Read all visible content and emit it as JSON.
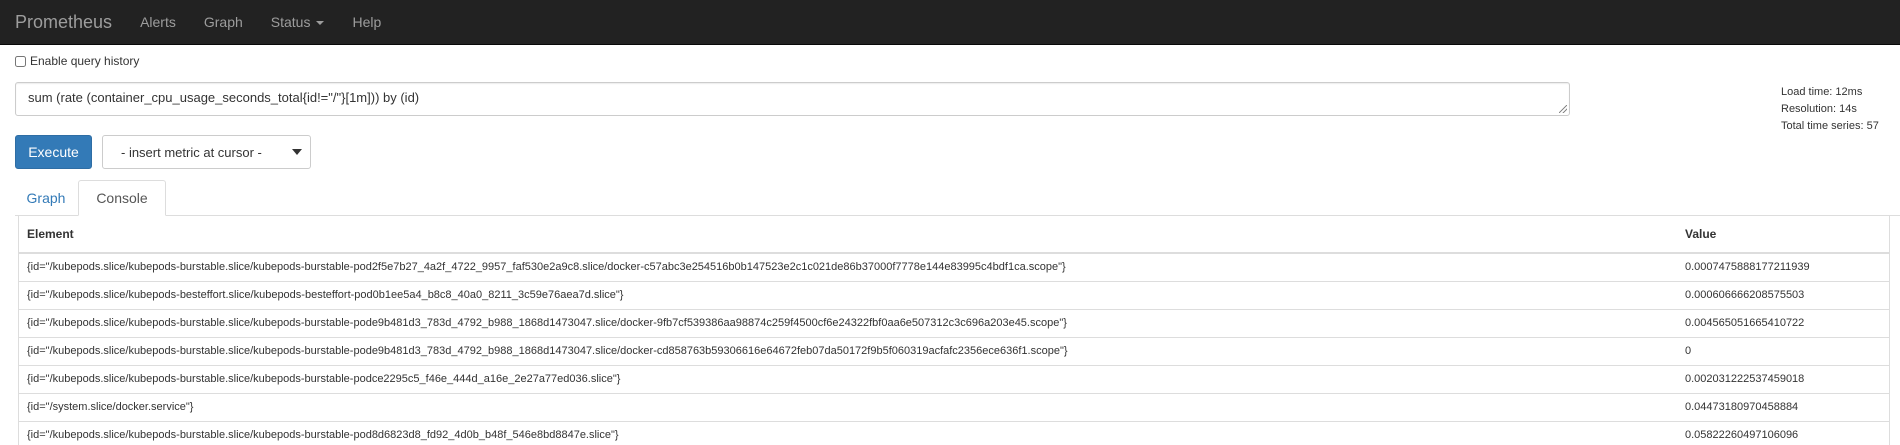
{
  "nav": {
    "brand": "Prometheus",
    "items": [
      {
        "label": "Alerts"
      },
      {
        "label": "Graph"
      },
      {
        "label": "Status"
      },
      {
        "label": "Help"
      }
    ]
  },
  "query_history": {
    "label": "Enable query history",
    "checked": false
  },
  "query": {
    "value": "sum (rate (container_cpu_usage_seconds_total{id!=\"/\"}[1m])) by (id)"
  },
  "stats": {
    "load_time": "Load time: 12ms",
    "resolution": "Resolution: 14s",
    "total_series": "Total time series: 57"
  },
  "actions": {
    "execute_label": "Execute",
    "metric_select_value": "- insert metric at cursor -"
  },
  "tabs": [
    {
      "label": "Graph",
      "active": false
    },
    {
      "label": "Console",
      "active": true
    }
  ],
  "table": {
    "columns": [
      "Element",
      "Value"
    ],
    "rows": [
      {
        "element": "{id=\"/kubepods.slice/kubepods-burstable.slice/kubepods-burstable-pod2f5e7b27_4a2f_4722_9957_faf530e2a9c8.slice/docker-c57abc3e254516b0b147523e2c1c021de86b37000f7778e144e83995c4bdf1ca.scope\"}",
        "value": "0.0007475888177211939"
      },
      {
        "element": "{id=\"/kubepods.slice/kubepods-besteffort.slice/kubepods-besteffort-pod0b1ee5a4_b8c8_40a0_8211_3c59e76aea7d.slice\"}",
        "value": "0.000606666208575503"
      },
      {
        "element": "{id=\"/kubepods.slice/kubepods-burstable.slice/kubepods-burstable-pode9b481d3_783d_4792_b988_1868d1473047.slice/docker-9fb7cf539386aa98874c259f4500cf6e24322fbf0aa6e507312c3c696a203e45.scope\"}",
        "value": "0.004565051665410722"
      },
      {
        "element": "{id=\"/kubepods.slice/kubepods-burstable.slice/kubepods-burstable-pode9b481d3_783d_4792_b988_1868d1473047.slice/docker-cd858763b59306616e64672feb07da50172f9b5f060319acfafc2356ece636f1.scope\"}",
        "value": "0"
      },
      {
        "element": "{id=\"/kubepods.slice/kubepods-burstable.slice/kubepods-burstable-podce2295c5_f46e_444d_a16e_2e27a77ed036.slice\"}",
        "value": "0.002031222537459018"
      },
      {
        "element": "{id=\"/system.slice/docker.service\"}",
        "value": "0.04473180970458884"
      },
      {
        "element": "{id=\"/kubepods.slice/kubepods-burstable.slice/kubepods-burstable-pod8d6823d8_fd92_4d0b_b48f_546e8bd8847e.slice\"}",
        "value": "0.05822260497106096"
      }
    ]
  }
}
